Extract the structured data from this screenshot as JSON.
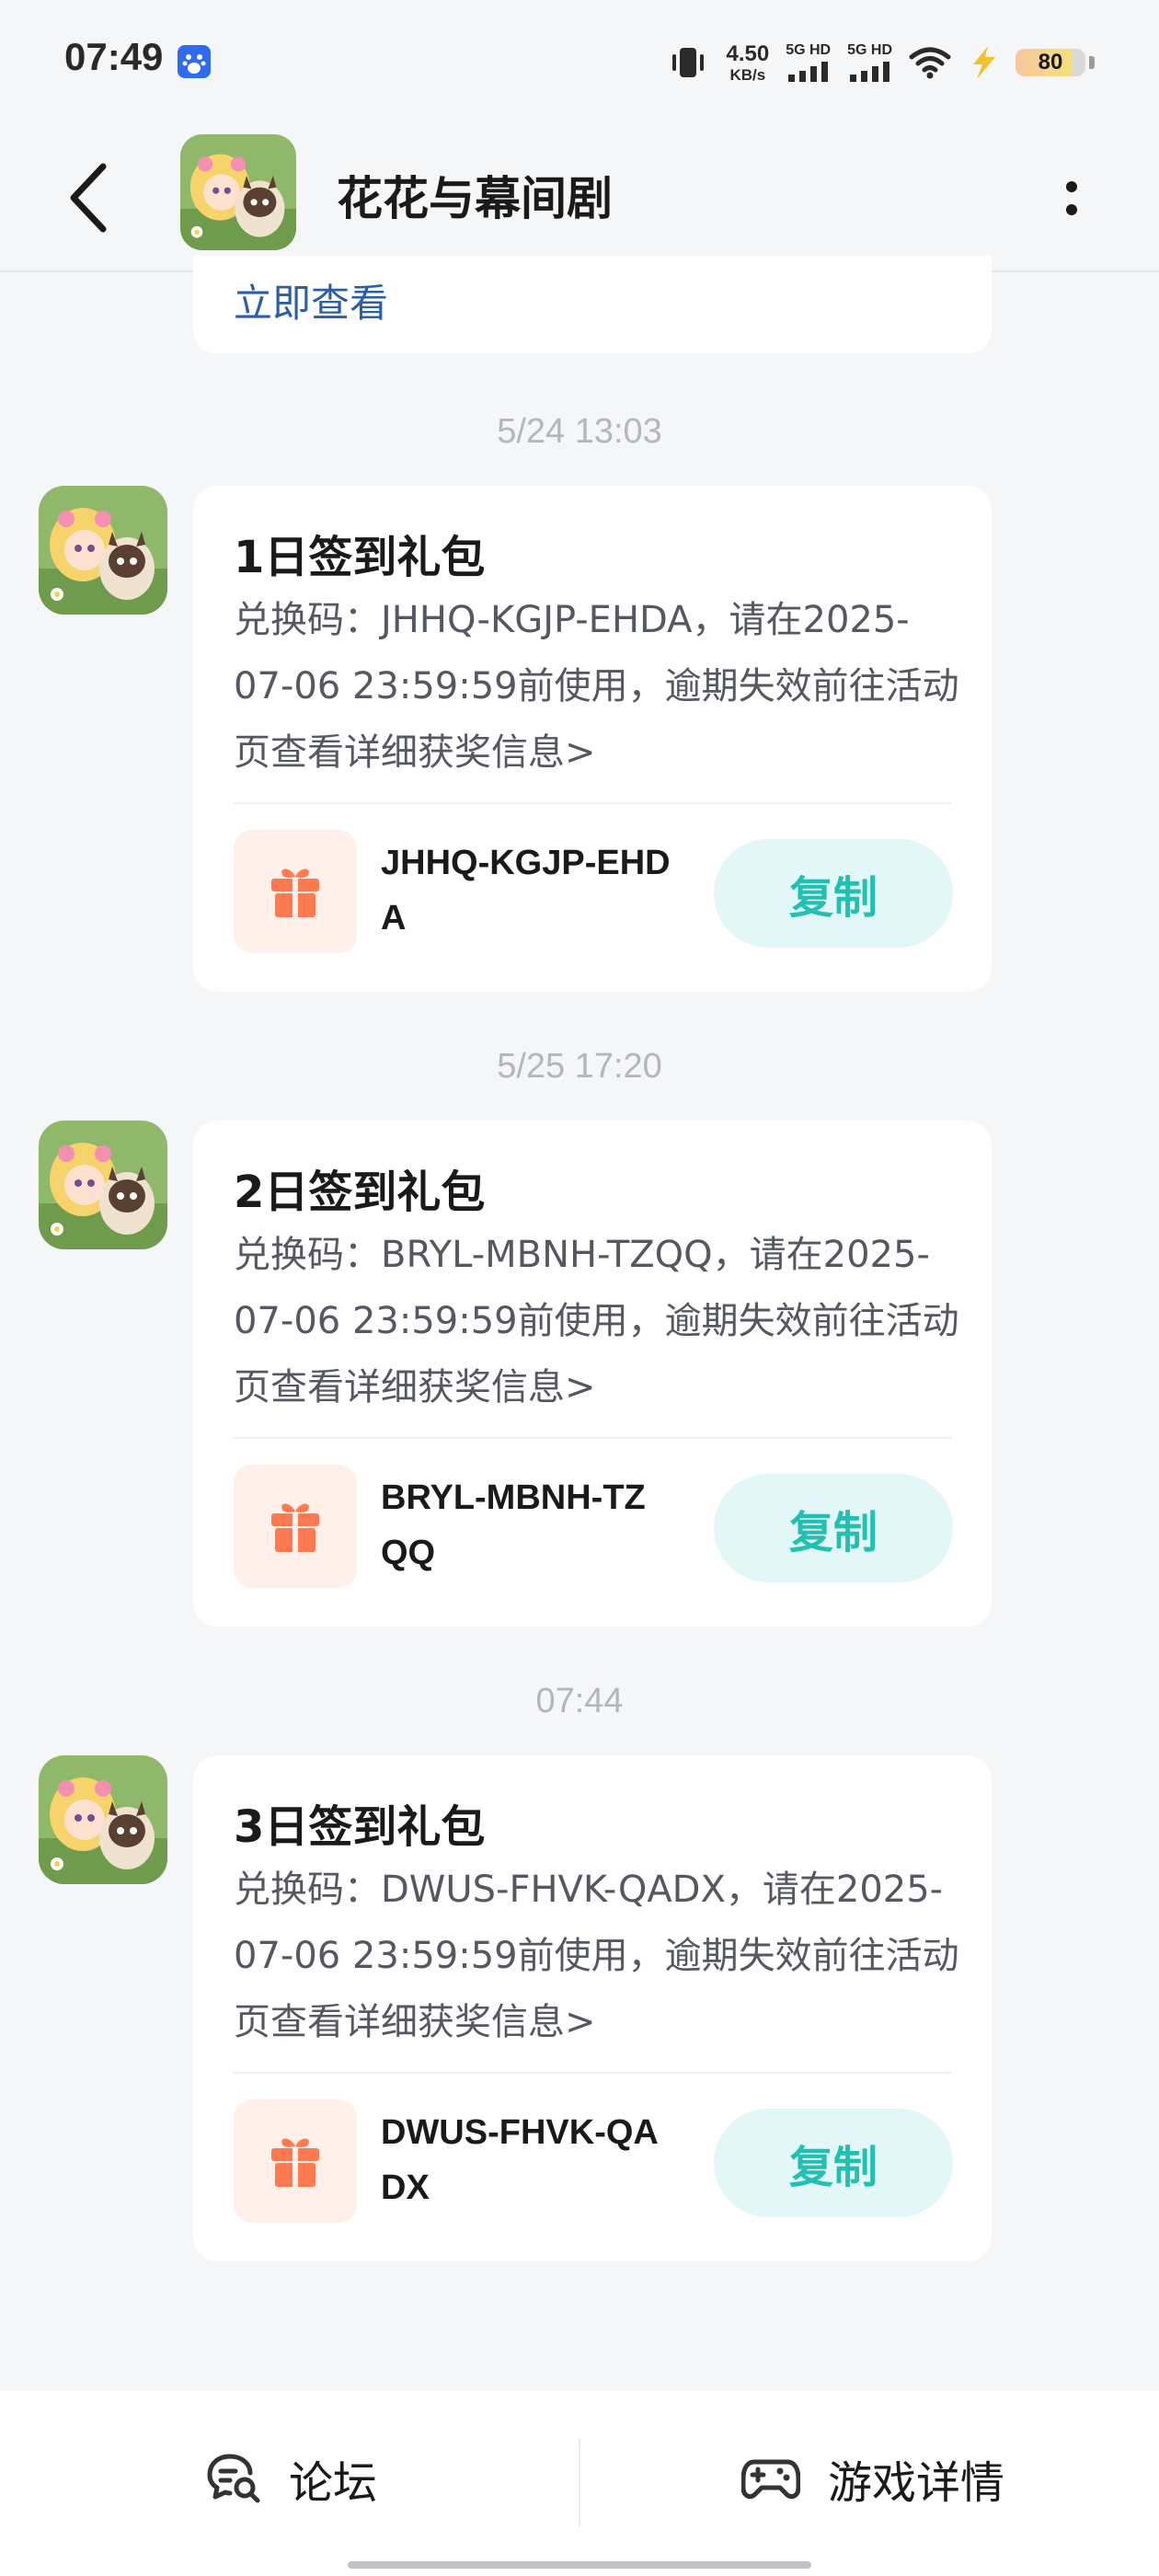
{
  "status_bar": {
    "time": "07:49",
    "net_speed_value": "4.50",
    "net_speed_unit": "KB/s",
    "sim1_label": "5G HD",
    "sim2_label": "5G HD",
    "battery_level": "80",
    "icons": [
      "baidu-app-icon",
      "vibrate-icon",
      "signal-icon",
      "wifi-icon",
      "charging-icon",
      "battery-icon"
    ]
  },
  "header": {
    "title": "花花与幕间剧",
    "back_icon": "chevron-left-icon",
    "more_icon": "more-vertical-icon"
  },
  "previous_message": {
    "link_text": "立即查看"
  },
  "messages": [
    {
      "timestamp": "5/24  13:03",
      "title": "1日签到礼包",
      "body": "兑换码：JHHQ-KGJP-EHDA，请在2025-07-06 23:59:59前使用，逾期失效前往活动页查看详细获奖信息>",
      "code_line1": "JHHQ-KGJP-EHD",
      "code_line2": "A",
      "copy_label": "复制"
    },
    {
      "timestamp": "5/25  17:20",
      "title": "2日签到礼包",
      "body": "兑换码：BRYL-MBNH-TZQQ，请在2025-07-06 23:59:59前使用，逾期失效前往活动页查看详细获奖信息>",
      "code_line1": "BRYL-MBNH-TZ",
      "code_line2": "QQ",
      "copy_label": "复制"
    },
    {
      "timestamp": "07:44",
      "title": "3日签到礼包",
      "body": "兑换码：DWUS-FHVK-QADX，请在2025-07-06 23:59:59前使用，逾期失效前往活动页查看详细获奖信息>",
      "code_line1": "DWUS-FHVK-QA",
      "code_line2": "DX",
      "copy_label": "复制"
    }
  ],
  "bottom_bar": {
    "forum_label": "论坛",
    "game_details_label": "游戏详情"
  },
  "colors": {
    "background": "#f5f6f8",
    "card": "#ffffff",
    "link": "#2b5ea7",
    "copy_text": "#21c0b3",
    "copy_bg": "#e3f8f6",
    "gift": "#ff7a50",
    "gift_bg": "#fff0ea"
  }
}
